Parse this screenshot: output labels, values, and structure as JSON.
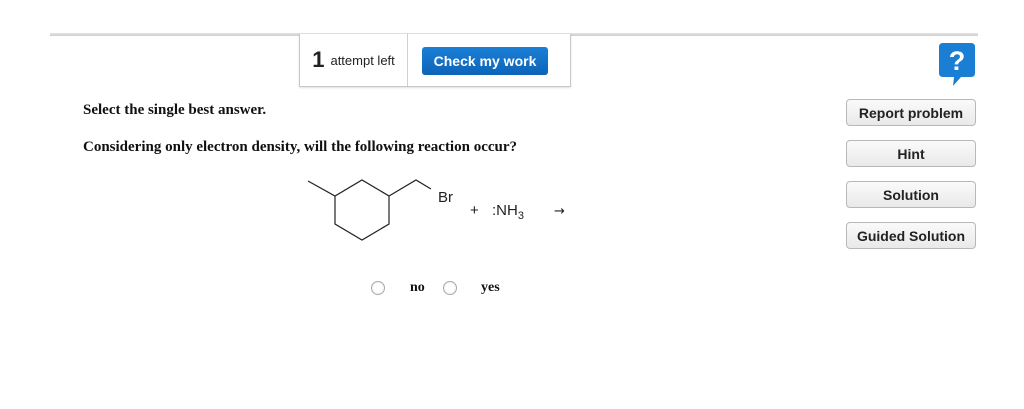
{
  "attempts": {
    "count": "1",
    "label": "attempt left"
  },
  "toolbar": {
    "check_label": "Check my work"
  },
  "help": {
    "glyph": "?",
    "color": "#1a7fd4"
  },
  "sidebar": {
    "buttons": [
      {
        "label": "Report problem"
      },
      {
        "label": "Hint"
      },
      {
        "label": "Solution"
      },
      {
        "label": "Guided Solution"
      }
    ]
  },
  "question": {
    "instruction": "Select the single best answer.",
    "prompt": "Considering only electron density, will the following reaction occur?",
    "reaction": {
      "substituent": "Br",
      "plus": "+",
      "reagent_prefix": ":NH",
      "reagent_subscript": "3",
      "arrow": "→"
    },
    "options": [
      {
        "label": "no",
        "selected": false
      },
      {
        "label": "yes",
        "selected": false
      }
    ]
  }
}
